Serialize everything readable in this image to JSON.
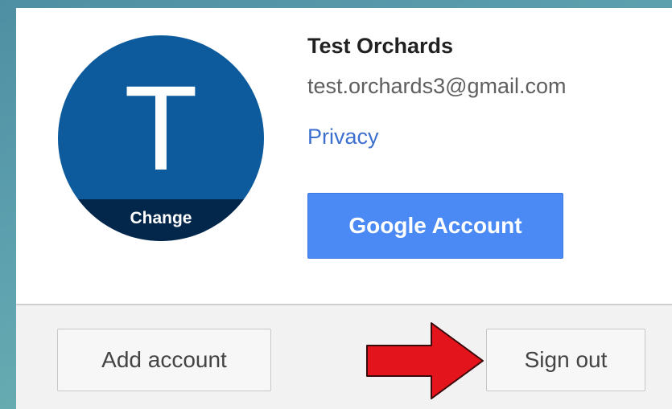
{
  "account": {
    "avatar_initial": "T",
    "change_label": "Change",
    "name": "Test Orchards",
    "email": "test.orchards3@gmail.com",
    "privacy_label": "Privacy",
    "google_account_label": "Google Account"
  },
  "footer": {
    "add_account_label": "Add account",
    "sign_out_label": "Sign out"
  },
  "colors": {
    "avatar_bg": "#0d5b9c",
    "accent_blue": "#4b8af5",
    "link_blue": "#3d6fce",
    "arrow_red": "#e3141b"
  },
  "icons": {
    "annotation": "red-arrow-icon"
  }
}
